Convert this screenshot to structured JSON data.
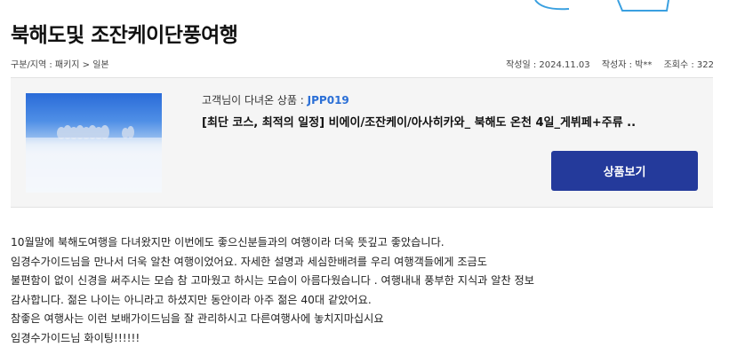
{
  "page": {
    "title": "북해도및 조잔케이단풍여행"
  },
  "meta": {
    "category": "구분/지역 : 패키지 > 일본",
    "date": "작성일 : 2024.11.03",
    "author": "작성자 : 박**",
    "views": "조회수 : 322"
  },
  "product": {
    "label_prefix": "고객님이 다녀온 상품 : ",
    "code": "JPP019",
    "name": "[최단 코스, 최적의 일정] 비에이/조잔케이/아사히카와_ 북해도 온천 4일_게뷔페+주류 ..",
    "button_label": "상품보기",
    "thumbnail_icon": "snowy-field-trees-image"
  },
  "review": {
    "lines": [
      "10월말에 북해도여행을 다녀왔지만 이번에도 좋으신분들과의 여행이라 더욱 뜻깊고 좋았습니다.",
      "임경수가이드님을 만나서 더욱 알찬 여행이었어요. 자세한 설명과 세심한배려를 우리 여행객들에게 조금도",
      "불편함이 없이 신경을  써주시는 모습 참 고마웠고 하시는 모습이 아름다웠습니다 . 여행내내 풍부한 지식과 알찬 정보",
      "감사합니다. 젊은 나이는 아니라고 하셨지만 동안이라 아주 젊은 40대 같았어요.",
      "참좋은 여행사는 이런 보배가이드님을 잘 관리하시고 다른여행사에 놓치지마십시요",
      "임경수가이드님  화이팅!!!!!!"
    ]
  },
  "colors": {
    "accent_blue": "#2b6fd6",
    "button_bg": "#243a9b",
    "box_bg": "#f5f5f5"
  }
}
